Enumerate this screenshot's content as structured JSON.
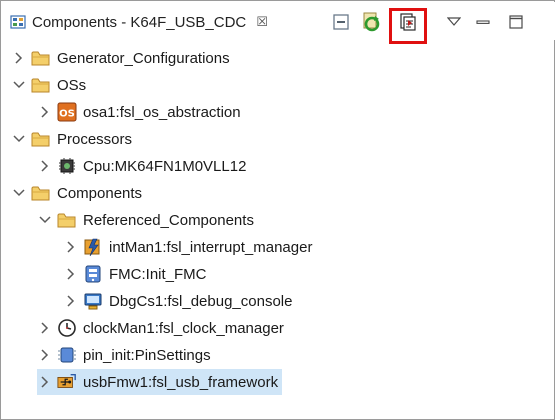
{
  "view": {
    "title": "Components - K64F_USB_CDC",
    "close_glyph": "☒"
  },
  "toolbar": [
    {
      "name": "collapse-all-icon"
    },
    {
      "name": "refresh-icon"
    },
    {
      "name": "generate-code-icon",
      "highlighted": true
    },
    {
      "name": "view-menu-icon"
    },
    {
      "name": "minimize-icon"
    },
    {
      "name": "maximize-icon"
    }
  ],
  "tree": {
    "items": [
      {
        "label": "Generator_Configurations",
        "depth": 0,
        "expanded": false,
        "icon": "folder-icon"
      },
      {
        "label": "OSs",
        "depth": 0,
        "expanded": true,
        "icon": "folder-icon"
      },
      {
        "label": "osa1:fsl_os_abstraction",
        "depth": 1,
        "expanded": false,
        "icon": "os-component-icon"
      },
      {
        "label": "Processors",
        "depth": 0,
        "expanded": true,
        "icon": "folder-icon"
      },
      {
        "label": "Cpu:MK64FN1M0VLL12",
        "depth": 1,
        "expanded": false,
        "icon": "cpu-chip-icon"
      },
      {
        "label": "Components",
        "depth": 0,
        "expanded": true,
        "icon": "folder-icon"
      },
      {
        "label": "Referenced_Components",
        "depth": 1,
        "expanded": true,
        "icon": "folder-icon"
      },
      {
        "label": "intMan1:fsl_interrupt_manager",
        "depth": 2,
        "expanded": false,
        "icon": "interrupt-manager-icon"
      },
      {
        "label": "FMC:Init_FMC",
        "depth": 2,
        "expanded": false,
        "icon": "init-component-icon"
      },
      {
        "label": "DbgCs1:fsl_debug_console",
        "depth": 2,
        "expanded": false,
        "icon": "debug-console-icon"
      },
      {
        "label": "clockMan1:fsl_clock_manager",
        "depth": 1,
        "expanded": false,
        "icon": "clock-manager-icon"
      },
      {
        "label": "pin_init:PinSettings",
        "depth": 1,
        "expanded": false,
        "icon": "pin-settings-icon"
      },
      {
        "label": "usbFmw1:fsl_usb_framework",
        "depth": 1,
        "expanded": false,
        "icon": "usb-framework-icon",
        "selected": true
      }
    ]
  },
  "colors": {
    "selection": "#cfe5f7",
    "highlight_border": "#e01010",
    "folder": "#e8b84a"
  }
}
